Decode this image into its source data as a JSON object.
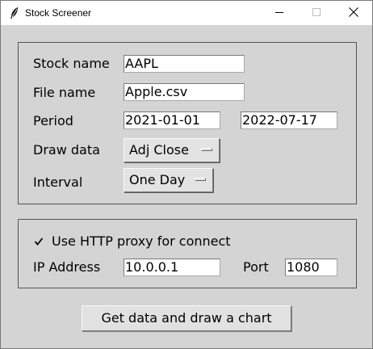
{
  "window": {
    "title": "Stock Screener",
    "icon": "feather-icon",
    "controls": [
      "minimize-icon",
      "maximize-icon",
      "close-icon"
    ]
  },
  "form": {
    "stock_name": {
      "label": "Stock name",
      "value": "AAPL"
    },
    "file_name": {
      "label": "File name",
      "value": "Apple.csv"
    },
    "period": {
      "label": "Period",
      "start": "2021-01-01",
      "end": "2022-07-17"
    },
    "draw_data": {
      "label": "Draw data",
      "selected": "Adj Close"
    },
    "interval": {
      "label": "Interval",
      "selected": "One Day"
    }
  },
  "proxy": {
    "checkbox_label": "Use HTTP proxy for connect",
    "checked": true,
    "ip_label": "IP Address",
    "ip_value": "10.0.0.1",
    "port_label": "Port",
    "port_value": "1080"
  },
  "actions": {
    "submit_label": "Get data and draw a chart"
  }
}
